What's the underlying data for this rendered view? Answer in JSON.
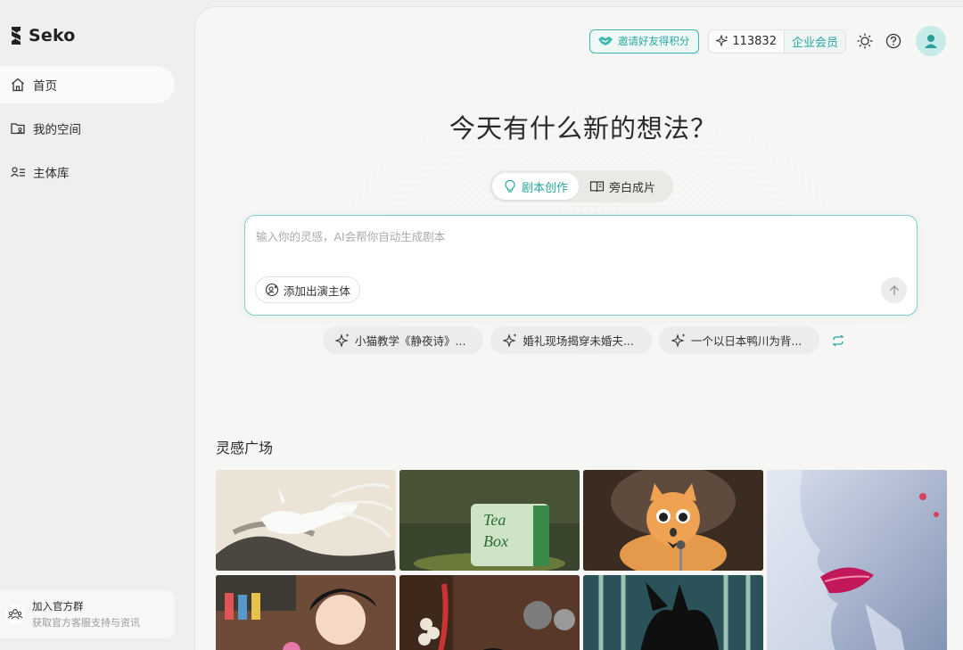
{
  "app": {
    "name": "Seko"
  },
  "sidebar": {
    "items": [
      {
        "label": "首页",
        "icon": "home-icon",
        "active": true
      },
      {
        "label": "我的空间",
        "icon": "folder-user-icon",
        "active": false
      },
      {
        "label": "主体库",
        "icon": "user-list-icon",
        "active": false
      }
    ],
    "join": {
      "title": "加入官方群",
      "subtitle": "获取官方客服支持与资讯",
      "icon": "group-icon"
    }
  },
  "topbar": {
    "invite_label": "邀请好友得积分",
    "credits": "113832",
    "member_label": "企业会员",
    "icons": [
      "handshake-icon",
      "sparkle-icon",
      "sun-icon",
      "help-icon",
      "user-avatar-icon"
    ]
  },
  "main": {
    "headline": "今天有什么新的想法？",
    "modes": [
      {
        "label": "剧本创作",
        "icon": "lightbulb-icon",
        "active": true
      },
      {
        "label": "旁白成片",
        "icon": "book-icon",
        "active": false
      }
    ],
    "prompt": {
      "placeholder": "输入你的灵感，AI会帮你自动生成剧本",
      "value": "",
      "add_subject_label": "添加出演主体"
    },
    "suggestions": [
      "小猫教学《静夜诗》...",
      "婚礼现场揭穿未婚夫...",
      "一个以日本鸭川为背..."
    ],
    "gallery_title": "灵感广场"
  },
  "colors": {
    "accent": "#2aa6a0",
    "accent_border": "#7fcfcb",
    "bg": "#efefed",
    "panel": "#f6f6f4"
  }
}
